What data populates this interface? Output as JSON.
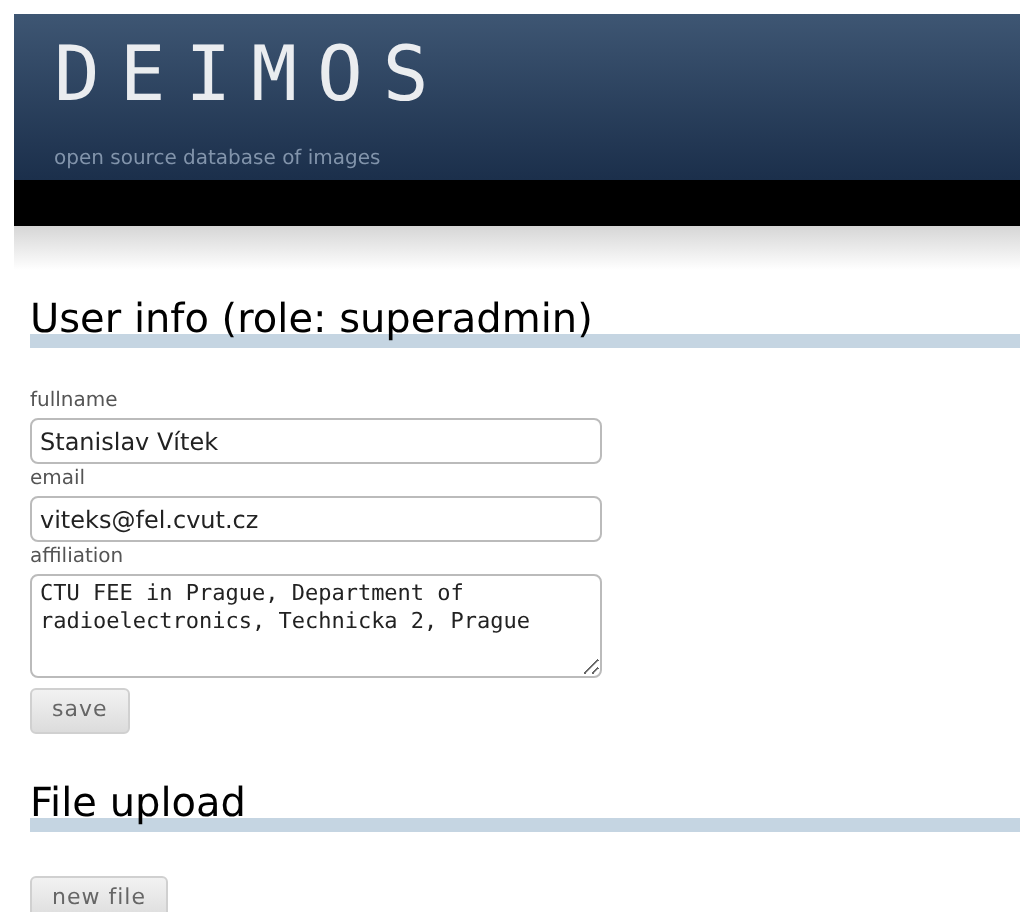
{
  "header": {
    "logo": "DEIMOS",
    "tagline": "open source database of images"
  },
  "user_info": {
    "title": "User info (role: superadmin)",
    "fields": [
      {
        "kind": "input",
        "label": "fullname",
        "value": "Stanislav Vítek"
      },
      {
        "kind": "input",
        "label": "email",
        "value": "viteks@fel.cvut.cz"
      },
      {
        "kind": "textarea",
        "label": "affiliation",
        "value": "CTU FEE in Prague, Department of radioelectronics, Technicka 2, Prague"
      }
    ],
    "button": "save"
  },
  "file_upload": {
    "title": "File upload",
    "button": "new file"
  }
}
